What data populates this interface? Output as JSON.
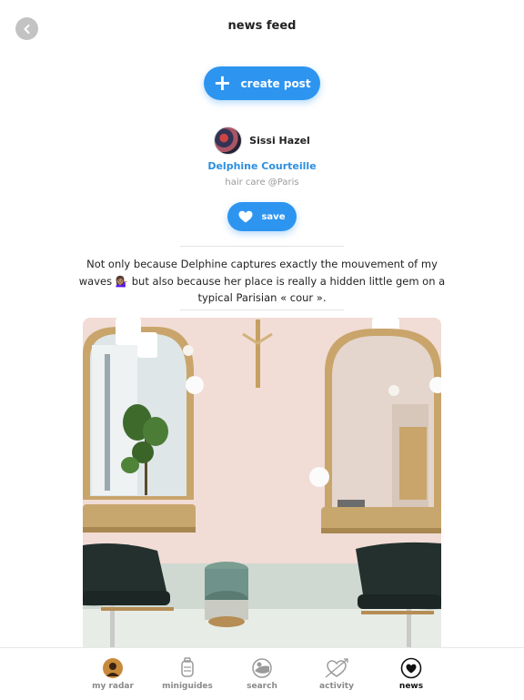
{
  "header": {
    "title": "news feed"
  },
  "actions": {
    "create_post": "create post",
    "save": "save"
  },
  "post": {
    "author_name": "Sissi Hazel",
    "salon_name": "Delphine Courteille",
    "salon_meta": "hair care @Paris",
    "text": "Not only because Delphine captures exactly the mouvement of my waves 💁🏽‍♀️ but also because her place is really a hidden little gem on a typical Parisian « cour »."
  },
  "tabs": [
    {
      "label": "my radar",
      "icon": "radar-avatar-icon",
      "active": false
    },
    {
      "label": "miniguides",
      "icon": "miniguides-icon",
      "active": false
    },
    {
      "label": "search",
      "icon": "search-map-icon",
      "active": false
    },
    {
      "label": "activity",
      "icon": "activity-heart-icon",
      "active": false
    },
    {
      "label": "news",
      "icon": "news-heart-icon",
      "active": true
    }
  ],
  "colors": {
    "accent": "#2d95f0",
    "link": "#2d8fe0",
    "back_button": "#c3c3c3"
  }
}
